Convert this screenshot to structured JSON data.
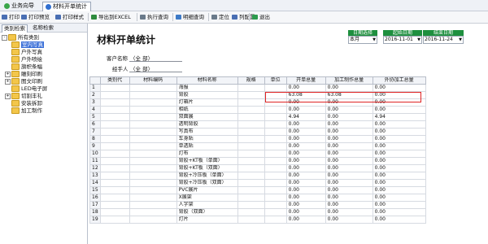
{
  "tabs": [
    {
      "label": "业务向导",
      "active": false,
      "icon_color": "#3aa64a"
    },
    {
      "label": "材料开单统计",
      "active": true,
      "icon_color": "#2f6fd0"
    }
  ],
  "toolbar": [
    {
      "label": "打印",
      "icon": "printer-icon",
      "color": "#4a6fb3"
    },
    {
      "label": "打印预览",
      "icon": "preview-icon",
      "color": "#4a6fb3"
    },
    {
      "label": "打印样式",
      "icon": "print-style-icon",
      "color": "#4a6fb3"
    },
    {
      "label": "导出到EXCEL",
      "icon": "excel-icon",
      "color": "#2e8b3e"
    },
    {
      "label": "执行查询",
      "icon": "search-icon",
      "color": "#6a7a8a"
    },
    {
      "label": "明细查询",
      "icon": "detail-icon",
      "color": "#3d7ac7"
    },
    {
      "label": "定位",
      "icon": "locate-icon",
      "color": "#6a7a8a"
    },
    {
      "label": "列配置",
      "icon": "columns-icon",
      "color": "#4a6fb3"
    },
    {
      "label": "退出",
      "icon": "exit-icon",
      "color": "#2e9b4e"
    }
  ],
  "left_panel": {
    "tabs": [
      "类别检索",
      "名称检索"
    ],
    "tree": [
      {
        "label": "所有类别",
        "level": 0,
        "expander": "-",
        "selected": false
      },
      {
        "label": "室内写真",
        "level": 1,
        "expander": "",
        "selected": true
      },
      {
        "label": "户外写真",
        "level": 1,
        "expander": "",
        "selected": false
      },
      {
        "label": "户外喷绘",
        "level": 1,
        "expander": "",
        "selected": false
      },
      {
        "label": "旗帜条幅",
        "level": 1,
        "expander": "",
        "selected": false
      },
      {
        "label": "雕刻印刷",
        "level": 1,
        "expander": "+",
        "selected": false
      },
      {
        "label": "图文印刷",
        "level": 1,
        "expander": "+",
        "selected": false
      },
      {
        "label": "LED电子屏",
        "level": 1,
        "expander": "",
        "selected": false
      },
      {
        "label": "切割丰礼",
        "level": 1,
        "expander": "+",
        "selected": false
      },
      {
        "label": "安装拆卸",
        "level": 1,
        "expander": "",
        "selected": false
      },
      {
        "label": "加工制作",
        "level": 1,
        "expander": "",
        "selected": false
      }
    ]
  },
  "main": {
    "title": "材料开单统计",
    "date_filter": {
      "range_label": "日期选择",
      "range_value": "本月",
      "start_label": "起始日期",
      "start_value": "2016-11-01",
      "end_label": "结束日期",
      "end_value": "2016-11-24"
    },
    "customer_label": "客户名称",
    "customer_value": "〈全  部〉",
    "handler_label": "经手人",
    "handler_value": "〈全  部〉",
    "table": {
      "columns": [
        "类别代",
        "材料编码",
        "材料名称",
        "规格",
        "单位",
        "开单总量",
        "加工制作总量",
        "外协加工总量"
      ],
      "rows": [
        [
          "1",
          "",
          "",
          "海报",
          "",
          "",
          "0.00",
          "0.00",
          "0.00"
        ],
        [
          "2",
          "",
          "",
          "背胶",
          "",
          "",
          "63.08",
          "63.08",
          "0.00"
        ],
        [
          "3",
          "",
          "",
          "灯箱片",
          "",
          "",
          "0.00",
          "0.00",
          "0.00"
        ],
        [
          "4",
          "",
          "",
          "相纸",
          "",
          "",
          "0.00",
          "0.00",
          "0.00"
        ],
        [
          "5",
          "",
          "",
          "双面展",
          "",
          "",
          "4.94",
          "0.00",
          "4.94"
        ],
        [
          "6",
          "",
          "",
          "透明背胶",
          "",
          "",
          "0.00",
          "0.00",
          "0.00"
        ],
        [
          "7",
          "",
          "",
          "写真布",
          "",
          "",
          "0.00",
          "0.00",
          "0.00"
        ],
        [
          "8",
          "",
          "",
          "车身贴",
          "",
          "",
          "0.00",
          "0.00",
          "0.00"
        ],
        [
          "9",
          "",
          "",
          "单透贴",
          "",
          "",
          "0.00",
          "0.00",
          "0.00"
        ],
        [
          "10",
          "",
          "",
          "灯布",
          "",
          "",
          "0.00",
          "0.00",
          "0.00"
        ],
        [
          "11",
          "",
          "",
          "背胶+KT板（单面）",
          "",
          "",
          "0.00",
          "0.00",
          "0.00"
        ],
        [
          "12",
          "",
          "",
          "背胶+KT板（双面）",
          "",
          "",
          "0.00",
          "0.00",
          "0.00"
        ],
        [
          "13",
          "",
          "",
          "背胶+冷压板（单面）",
          "",
          "",
          "0.00",
          "0.00",
          "0.00"
        ],
        [
          "14",
          "",
          "",
          "背胶+冷压板（双面）",
          "",
          "",
          "0.00",
          "0.00",
          "0.00"
        ],
        [
          "15",
          "",
          "",
          "PVC展片",
          "",
          "",
          "0.00",
          "0.00",
          "0.00"
        ],
        [
          "16",
          "",
          "",
          "X展架",
          "",
          "",
          "0.00",
          "0.00",
          "0.00"
        ],
        [
          "17",
          "",
          "",
          "人字架",
          "",
          "",
          "0.00",
          "0.00",
          "0.00"
        ],
        [
          "18",
          "",
          "",
          "背胶（双面）",
          "",
          "",
          "0.00",
          "0.00",
          "0.00"
        ],
        [
          "19",
          "",
          "",
          "灯片",
          "",
          "",
          "0.00",
          "0.00",
          "0.00"
        ]
      ]
    }
  }
}
